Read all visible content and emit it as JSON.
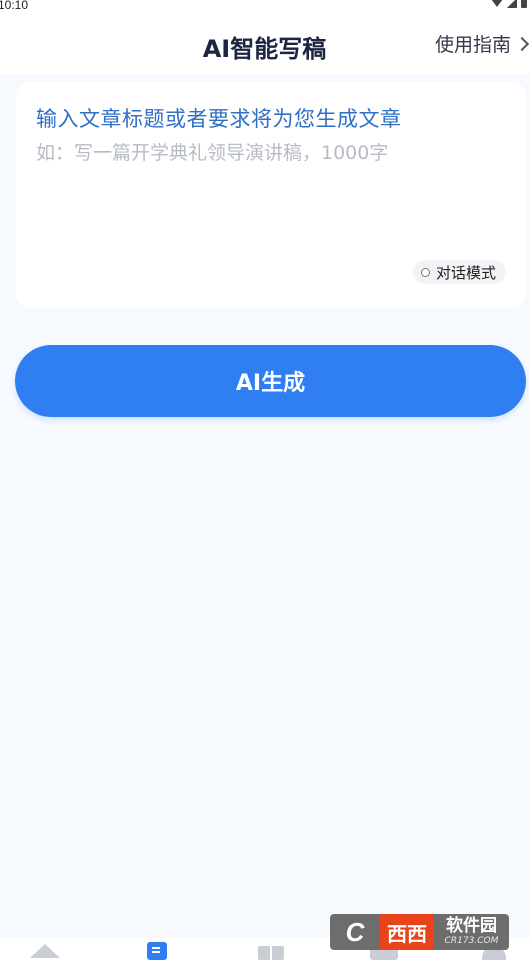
{
  "status_bar": {
    "time": "10:10"
  },
  "header": {
    "title": "AI智能写稿",
    "guide_link": "使用指南"
  },
  "input_card": {
    "prompt_title": "输入文章标题或者要求将为您生成文章",
    "placeholder": "如：写一篇开学典礼领导演讲稿，1000字",
    "mode_toggle_label": "对话模式"
  },
  "actions": {
    "generate_label": "AI生成"
  },
  "bottom_nav": {
    "items": [
      {
        "icon": "home-icon"
      },
      {
        "icon": "write-icon"
      },
      {
        "icon": "gift-icon"
      },
      {
        "icon": "message-icon"
      },
      {
        "icon": "user-icon"
      }
    ]
  },
  "watermark": {
    "logo": "C",
    "name_red": "西西",
    "name": "软件园",
    "domain": "CR173.COM"
  },
  "colors": {
    "accent": "#2f7ff3",
    "prompt_title": "#2f6fc6",
    "background": "#f6f9fe"
  }
}
